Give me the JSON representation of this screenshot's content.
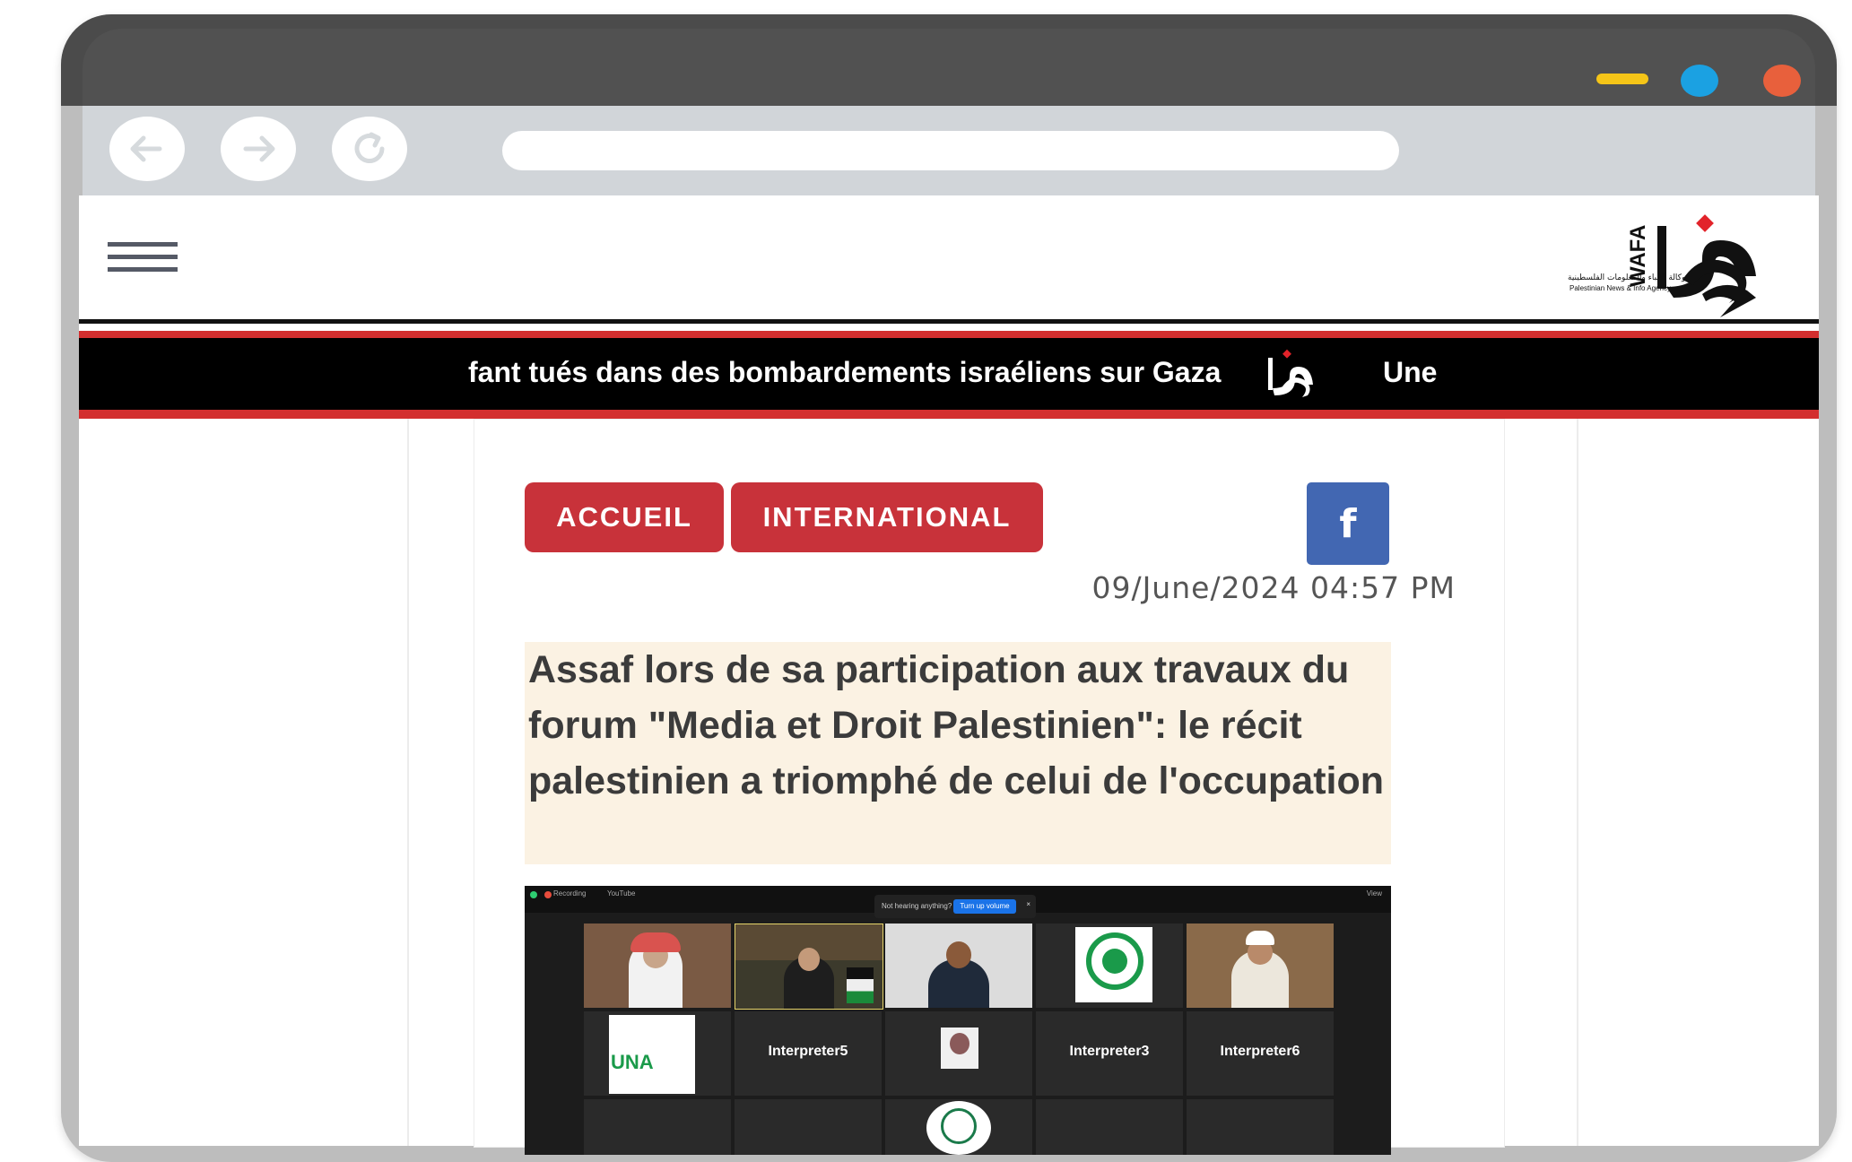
{
  "browser": {
    "colors": {
      "minimize": "#f5c518",
      "maximize": "#1ba1e2",
      "close": "#e8603c"
    },
    "nav": {
      "back_icon": "arrow-left-icon",
      "forward_icon": "arrow-right-icon",
      "reload_icon": "reload-icon"
    },
    "address": ""
  },
  "header": {
    "menu_icon": "hamburger-menu-icon",
    "logo": {
      "name": "WAFA",
      "arabic": "وكالة الأنباء والمعلومات الفلسطينية",
      "english": "Palestinian News & Info Agency"
    }
  },
  "ticker": {
    "text": "fant tués dans des bombardements israéliens sur Gaza",
    "next": "Une"
  },
  "article": {
    "breadcrumbs": [
      {
        "label": "ACCUEIL"
      },
      {
        "label": "INTERNATIONAL"
      }
    ],
    "share": {
      "label": "f",
      "icon": "facebook-icon"
    },
    "date": "09/June/2024 04:57 PM",
    "title": "Assaf lors de sa participation aux travaux du forum \"Media et Droit Palestinien\": le récit palestinien a triomphé de celui de l'occupation",
    "image": {
      "recording": "Recording",
      "youtube": "YouTube",
      "view": "View",
      "notice": "Not hearing anything?",
      "notice_button": "Turn up volume",
      "tiles": [
        {
          "label": ""
        },
        {
          "label": ""
        },
        {
          "label": ""
        },
        {
          "label": ""
        },
        {
          "label": ""
        },
        {
          "label": "UNA"
        },
        {
          "label": "Interpreter5"
        },
        {
          "label": ""
        },
        {
          "label": "Interpreter3"
        },
        {
          "label": "Interpreter6"
        }
      ]
    }
  },
  "colors": {
    "accent_red": "#c8323a",
    "facebook": "#4267b2",
    "headline_bg": "#fbf2e3"
  }
}
